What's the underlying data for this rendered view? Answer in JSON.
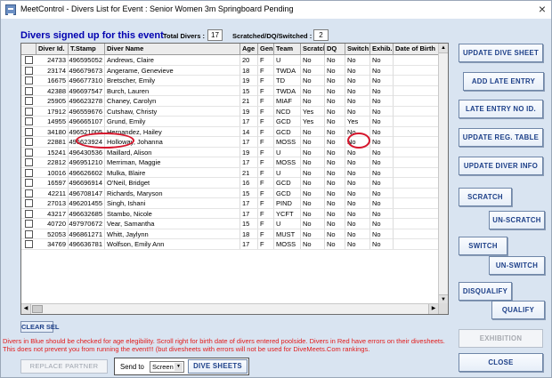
{
  "window": {
    "title": "MeetControl - Divers List for Event : Senior Women 3m Springboard Pending",
    "close_glyph": "×"
  },
  "header": {
    "heading": "Divers signed up for this event",
    "total_label": "Total Divers :",
    "total_value": "17",
    "scratched_label": "Scratched/DQ/Switched :",
    "scratched_value": "2"
  },
  "table": {
    "columns": [
      "",
      "Diver Id.",
      "T.Stamp",
      "Diver Name",
      "Age",
      "Gen.",
      "Team",
      "Scratch",
      "DQ",
      "Switch",
      "Exhib.",
      "Date of Birth"
    ],
    "rows": [
      [
        "24733",
        "496595052",
        "Andrews, Claire",
        "20",
        "F",
        "U",
        "No",
        "No",
        "No",
        "No"
      ],
      [
        "23174",
        "496679673",
        "Angerame, Genevieve",
        "18",
        "F",
        "TWDA",
        "No",
        "No",
        "No",
        "No"
      ],
      [
        "16675",
        "496677310",
        "Bretscher, Emily",
        "19",
        "F",
        "TD",
        "No",
        "No",
        "No",
        "No"
      ],
      [
        "42388",
        "496697547",
        "Burch, Lauren",
        "15",
        "F",
        "TWDA",
        "No",
        "No",
        "No",
        "No"
      ],
      [
        "25905",
        "496623278",
        "Chaney, Carolyn",
        "21",
        "F",
        "MIAF",
        "No",
        "No",
        "No",
        "No"
      ],
      [
        "17912",
        "496559676",
        "Cutshaw, Christy",
        "19",
        "F",
        "NCD",
        "Yes",
        "No",
        "No",
        "No"
      ],
      [
        "14955",
        "496665107",
        "Grund, Emily",
        "17",
        "F",
        "GCD",
        "Yes",
        "No",
        "Yes",
        "No"
      ],
      [
        "34180",
        "496521005",
        "Hernandez, Hailey",
        "14",
        "F",
        "GCD",
        "No",
        "No",
        "No",
        "No"
      ],
      [
        "22881",
        "496623924",
        "Holloway, Johanna",
        "17",
        "F",
        "MOSS",
        "No",
        "No",
        "No",
        "No"
      ],
      [
        "15241",
        "496430536",
        "Maillard, Alison",
        "19",
        "F",
        "U",
        "No",
        "No",
        "No",
        "No"
      ],
      [
        "22812",
        "496951210",
        "Merriman, Maggie",
        "17",
        "F",
        "MOSS",
        "No",
        "No",
        "No",
        "No"
      ],
      [
        "10016",
        "496626602",
        "Mulka, Blaire",
        "21",
        "F",
        "U",
        "No",
        "No",
        "No",
        "No"
      ],
      [
        "16597",
        "496696914",
        "O'Neil, Bridget",
        "16",
        "F",
        "GCD",
        "No",
        "No",
        "No",
        "No"
      ],
      [
        "42211",
        "496708147",
        "Richards, Maryson",
        "15",
        "F",
        "GCD",
        "No",
        "No",
        "No",
        "No"
      ],
      [
        "27013",
        "496201455",
        "Singh, Ishani",
        "17",
        "F",
        "PIND",
        "No",
        "No",
        "No",
        "No"
      ],
      [
        "43217",
        "496632685",
        "Stambo, Nicole",
        "17",
        "F",
        "YCFT",
        "No",
        "No",
        "No",
        "No"
      ],
      [
        "40720",
        "497970672",
        "Vear, Samantha",
        "15",
        "F",
        "U",
        "No",
        "No",
        "No",
        "No"
      ],
      [
        "52053",
        "496861271",
        "Whitt, Jaylynn",
        "18",
        "F",
        "MUST",
        "No",
        "No",
        "No",
        "No"
      ],
      [
        "34769",
        "496636781",
        "Wolfson, Emily Ann",
        "17",
        "F",
        "MOSS",
        "No",
        "No",
        "No",
        "No"
      ]
    ]
  },
  "buttons": {
    "update_dive_sheet": "UPDATE DIVE SHEET",
    "add_late_entry": "ADD LATE ENTRY",
    "late_entry_no_id": "LATE ENTRY NO ID.",
    "update_reg_table": "UPDATE REG. TABLE",
    "update_diver_info": "UPDATE DIVER INFO",
    "scratch": "SCRATCH",
    "unscratch": "UN-SCRATCH",
    "switch": "SWITCH",
    "unswitch": "UN-SWITCH",
    "disqualify": "DISQUALIFY",
    "qualify": "QUALIFY",
    "exhibition": "EXHIBITION",
    "close": "CLOSE",
    "clear_sel": "CLEAR SEL",
    "replace_partner": "REPLACE PARTNER",
    "dive_sheets": "DIVE SHEETS"
  },
  "footer": {
    "note": "Divers in Blue should be checked for age elegibility. Scroll right for birth date of divers entered poolside. Divers in Red have errors on their divesheets. This does not prevent you from running the event!!! (but divesheets with errors will not be used for DiveMeets.Com rankings.",
    "sendto_label": "Send to",
    "sendto_value": "Screen"
  },
  "colors": {
    "heading": "#0000b0",
    "note": "#e21b1b",
    "button_text": "#1c3f88",
    "highlight": "#d6152c"
  }
}
